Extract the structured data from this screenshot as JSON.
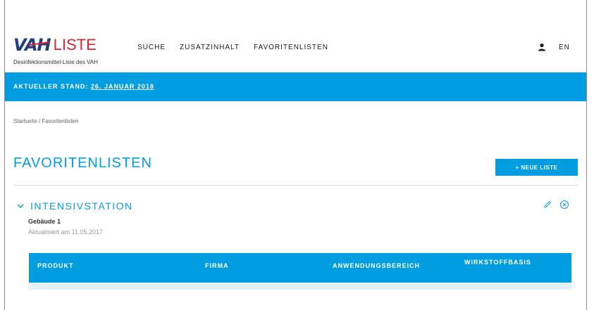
{
  "header": {
    "logo_vah": "VAH",
    "logo_liste": "LISTE",
    "tagline": "Desinfektionsmittel-Liste des VAH",
    "nav": [
      "SUCHE",
      "ZUSATZINHALT",
      "FAVORITENLISTEN"
    ],
    "language": "EN"
  },
  "status": {
    "prefix": "AKTUELLER STAND: ",
    "date": "26. JANUAR 2018"
  },
  "breadcrumb": "Startseite / Favoritenlisten",
  "page": {
    "title": "FAVORITENLISTEN",
    "new_list_button": "+ NEUE LISTE"
  },
  "list": {
    "title": "INTENSIVSTATION",
    "subtitle": "Gebäude 1",
    "updated": "Aktualisiert am 11.05.2017",
    "columns": [
      "PRODUKT",
      "FIRMA",
      "ANWENDUNGSBEREICH",
      "WIRKSTOFFBASIS"
    ]
  },
  "colors": {
    "accent": "#009ee0",
    "brand_red": "#d9232e",
    "brand_blue": "#1e3f78"
  },
  "icons": [
    "user-icon",
    "chevron-down-icon",
    "pencil-icon",
    "close-circle-icon"
  ]
}
